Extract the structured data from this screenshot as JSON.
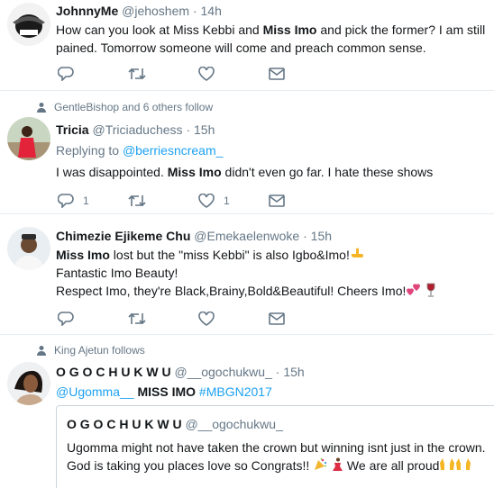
{
  "tweets": [
    {
      "name": "JohnnyMe",
      "handle": "@jehoshem",
      "time": "14h",
      "text_1": "How can you look at Miss Kebbi and ",
      "bold_1": "Miss Imo",
      "text_2": " and pick the former? I am still pained. Tomorrow someone will come and preach common sense."
    },
    {
      "social": "GentleBishop and 6 others follow",
      "name": "Tricia",
      "handle": "@Triciaduchess",
      "time": "15h",
      "reply_prefix": "Replying to ",
      "reply_to": "@berriesncream_",
      "text_1": "I was disappointed. ",
      "bold_1": "Miss Imo",
      "text_2": " didn't even go far. I hate these shows",
      "reply_count": "1",
      "like_count": "1"
    },
    {
      "name": "Chimezie Ejikeme Chu",
      "handle": "@Emekaelenwoke",
      "time": "15h",
      "bold_1": "Miss Imo",
      "line_1": " lost but the \"miss Kebbi\" is also Igbo&Imo!",
      "line_2": "Fantastic Imo Beauty!",
      "line_3": "Respect Imo, they're Black,Brainy,Bold&Beautiful! Cheers Imo!"
    },
    {
      "social": "King Ajetun follows",
      "name": "O G O C H U K W U",
      "handle": "@__ogochukwu_",
      "time": "15h",
      "mention": "@Ugomma__",
      "bold_1": "MISS IMO",
      "hashtag": "#MBGN2017",
      "quote": {
        "name": "O G O C H U K W U",
        "handle": "@__ogochukwu_",
        "line_1": "Ugomma might not have taken the crown but winning isnt just in the crown.",
        "line_2": "God is taking you places love so Congrats!! ",
        "line_3": " We are all proud"
      }
    }
  ],
  "dot": "·"
}
